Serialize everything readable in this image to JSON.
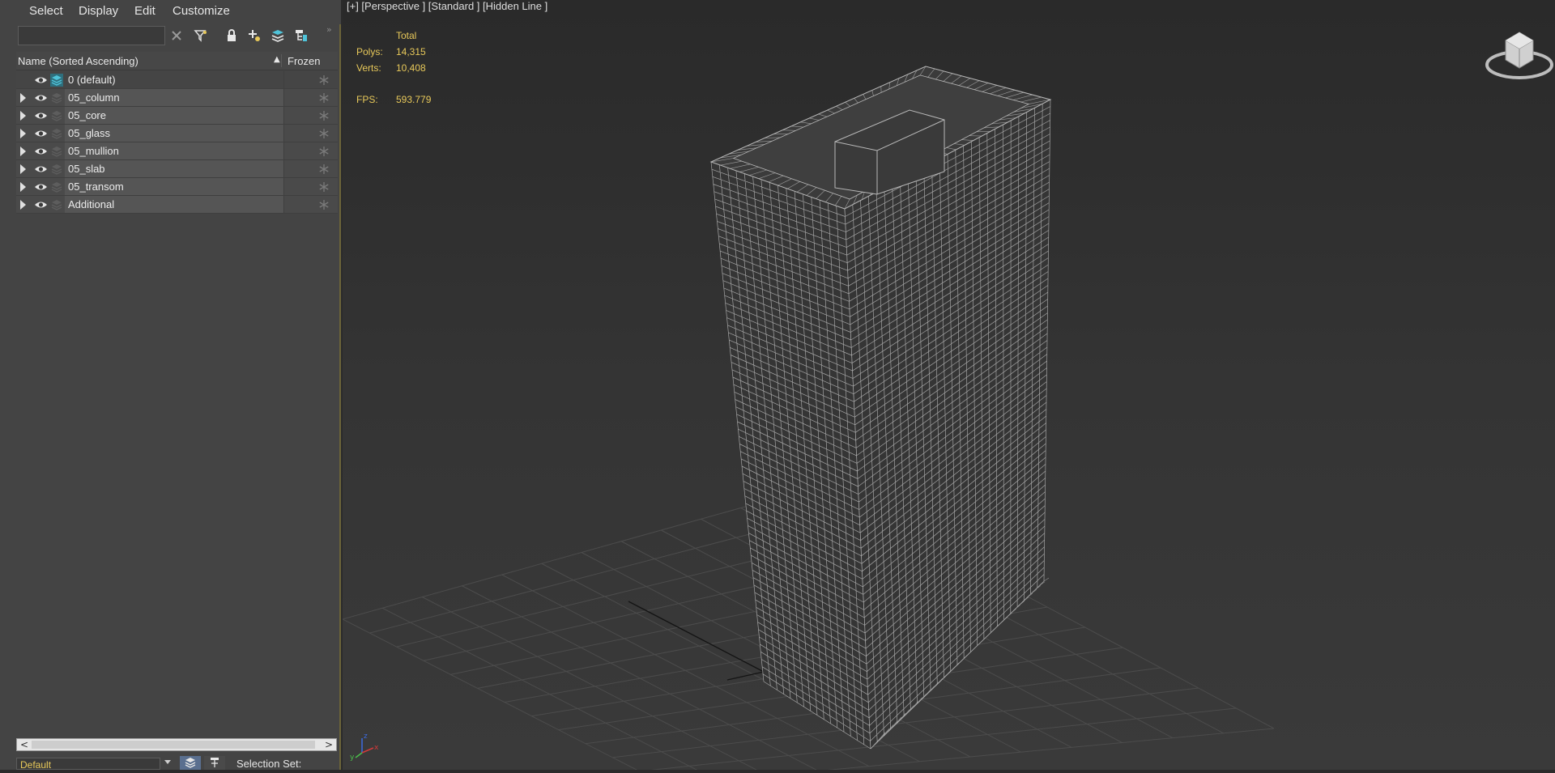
{
  "menu": {
    "select": "Select",
    "display": "Display",
    "edit": "Edit",
    "customize": "Customize"
  },
  "search": {
    "value": "",
    "placeholder": ""
  },
  "toolbar_icons": [
    "clear-icon",
    "filter-icon",
    "lock-icon",
    "add-layer-icon",
    "layers-icon",
    "hierarchy-icon"
  ],
  "overflow": "»",
  "columns": {
    "name": "Name (Sorted Ascending)",
    "sort_indicator": "▲",
    "frozen": "Frozen"
  },
  "layers": [
    {
      "label": "0 (default)",
      "expandable": false,
      "icon": "active-layer-icon"
    },
    {
      "label": "05_column",
      "expandable": true,
      "icon": "layer-icon"
    },
    {
      "label": "05_core",
      "expandable": true,
      "icon": "layer-icon"
    },
    {
      "label": "05_glass",
      "expandable": true,
      "icon": "layer-icon"
    },
    {
      "label": "05_mullion",
      "expandable": true,
      "icon": "layer-icon"
    },
    {
      "label": "05_slab",
      "expandable": true,
      "icon": "layer-icon"
    },
    {
      "label": "05_transom",
      "expandable": true,
      "icon": "layer-icon"
    },
    {
      "label": "Additional",
      "expandable": true,
      "icon": "layer-icon"
    }
  ],
  "scrollbar": {
    "left": "<",
    "right": ">"
  },
  "bottom": {
    "layer_dropdown": "Default",
    "selection_set": "Selection Set:"
  },
  "viewport": {
    "label": "[+] [Perspective ] [Standard ] [Hidden Line ]",
    "stats": {
      "header": "Total",
      "polys_label": "Polys:",
      "polys_value": "14,315",
      "verts_label": "Verts:",
      "verts_value": "10,408",
      "fps_label": "FPS:",
      "fps_value": "593.779"
    },
    "axes": {
      "x": "x",
      "y": "y",
      "z": "z"
    }
  },
  "colors": {
    "panel_bg": "#444444",
    "viewport_bg": "#2f2f2f",
    "stat_text": "#e8c95a",
    "wire": "#b8b8b8",
    "active_layer": "#4fc3d9"
  }
}
